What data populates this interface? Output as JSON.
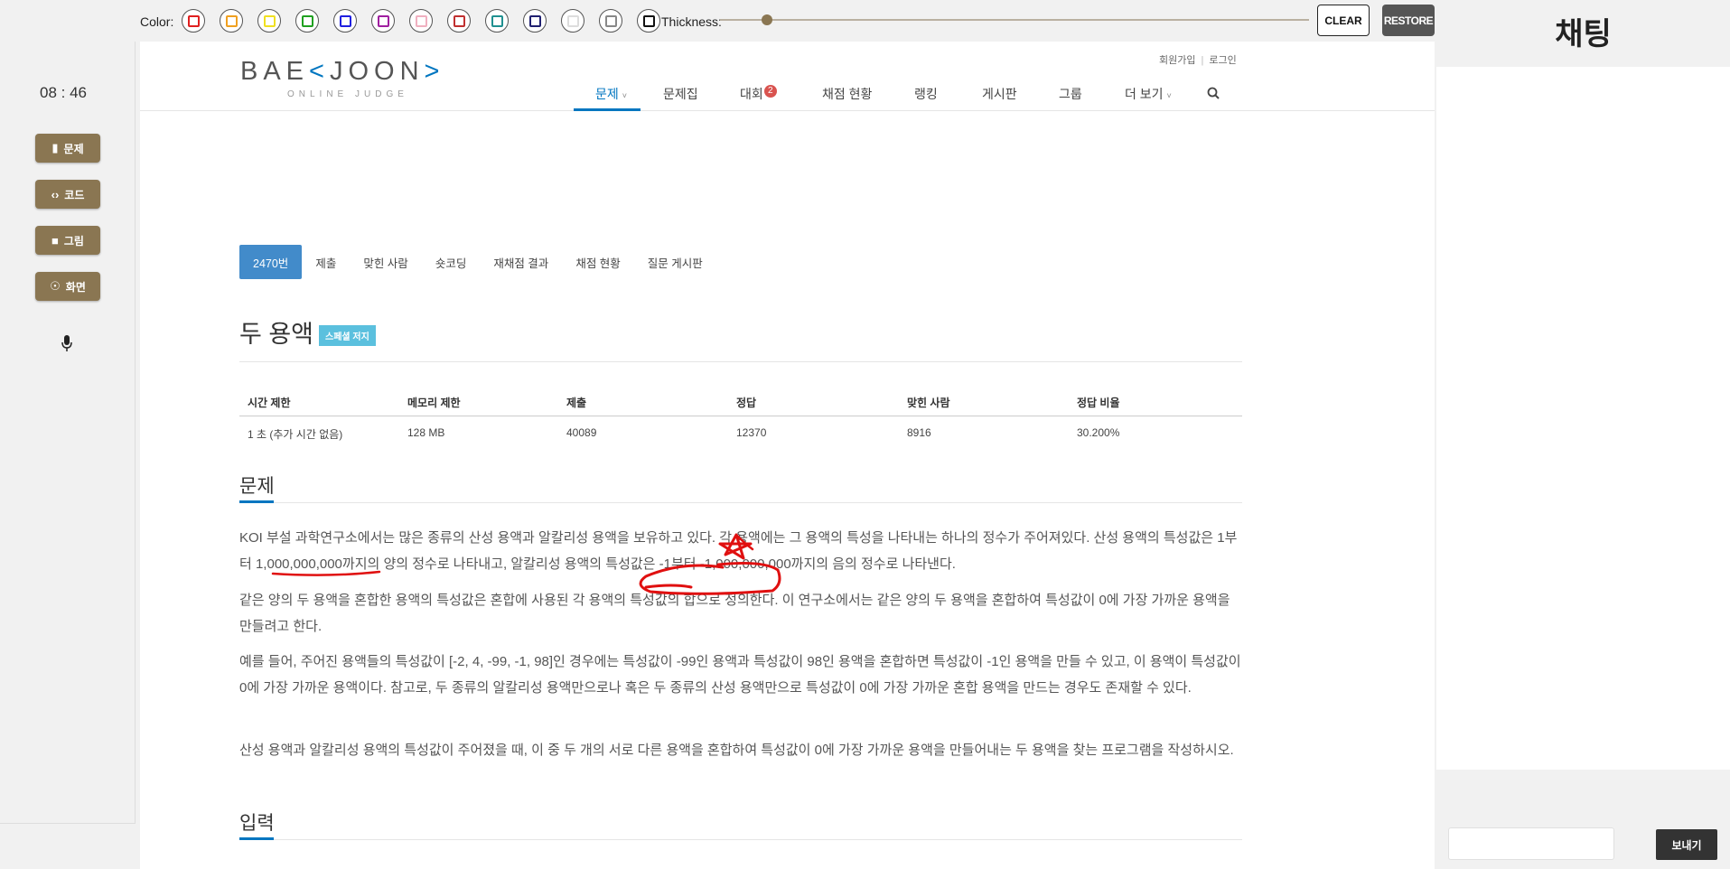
{
  "toolbar": {
    "color_label": "Color:",
    "swatch_colors": [
      "#e02020",
      "#f0a020",
      "#f0e020",
      "#20a020",
      "#2020e0",
      "#a020a0",
      "#f0b0c0",
      "#c03030",
      "#209090",
      "#202070",
      "#ffffff",
      "#888888",
      "#111111"
    ],
    "thickness_label": "Thickness:",
    "clear_label": "CLEAR",
    "restore_label": "RESTORE"
  },
  "sidebar": {
    "timer": "08 : 46",
    "buttons": [
      {
        "label": "문제",
        "icon": "chat-icon"
      },
      {
        "label": "코드",
        "icon": "code-icon"
      },
      {
        "label": "그림",
        "icon": "paint-roller-icon"
      },
      {
        "label": "화면",
        "icon": "broadcast-icon"
      }
    ],
    "mic_icon": "microphone-icon"
  },
  "site": {
    "logo_main": "BAEKJOON",
    "logo_sub": "ONLINE JUDGE",
    "top_links": [
      "회원가입",
      "로그인"
    ],
    "nav": [
      "문제",
      "문제집",
      "대회",
      "채점 현황",
      "랭킹",
      "게시판",
      "그룹",
      "더 보기"
    ],
    "nav_badge": "2",
    "search_icon": "search-icon"
  },
  "tabs": [
    "2470번",
    "제출",
    "맞힌 사람",
    "숏코딩",
    "재채점 결과",
    "채점 현황",
    "질문 게시판"
  ],
  "problem": {
    "title": "두 용액",
    "tag": "스페셜 저지",
    "table_headers": [
      "시간 제한",
      "메모리 제한",
      "제출",
      "정답",
      "맞힌 사람",
      "정답 비율"
    ],
    "table_values": [
      "1 초 (추가 시간 없음)",
      "128 MB",
      "40089",
      "12370",
      "8916",
      "30.200%"
    ],
    "section_problem": "문제",
    "paragraphs": [
      "KOI 부설 과학연구소에서는 많은 종류의 산성 용액과 알칼리성 용액을 보유하고 있다. 각 용액에는 그 용액의 특성을 나타내는 하나의 정수가 주어져있다. 산성 용액의 특성값은 1부터 1,000,000,000까지의 양의 정수로 나타내고, 알칼리성 용액의 특성값은 -1부터 -1,000,000,000까지의 음의 정수로 나타낸다.",
      "같은 양의 두 용액을 혼합한 용액의 특성값은 혼합에 사용된 각 용액의 특성값의 합으로 정의한다. 이 연구소에서는 같은 양의 두 용액을 혼합하여 특성값이 0에 가장 가까운 용액을 만들려고 한다.",
      "예를 들어, 주어진 용액들의 특성값이 [-2, 4, -99, -1, 98]인 경우에는 특성값이 -99인 용액과 특성값이 98인 용액을 혼합하면 특성값이 -1인 용액을 만들 수 있고, 이 용액이 특성값이 0에 가장 가까운 용액이다. 참고로, 두 종류의 알칼리성 용액만으로나 혹은 두 종류의 산성 용액만으로 특성값이 0에 가장 가까운 혼합 용액을 만드는 경우도 존재할 수 있다.",
      "산성 용액과 알칼리성 용액의 특성값이 주어졌을 때, 이 중 두 개의 서로 다른 용액을 혼합하여 특성값이 0에 가장 가까운 용액을 만들어내는 두 용액을 찾는 프로그램을 작성하시오."
    ],
    "section_input": "입력"
  },
  "chat": {
    "title": "채팅",
    "input_value": "",
    "send_label": "보내기"
  }
}
